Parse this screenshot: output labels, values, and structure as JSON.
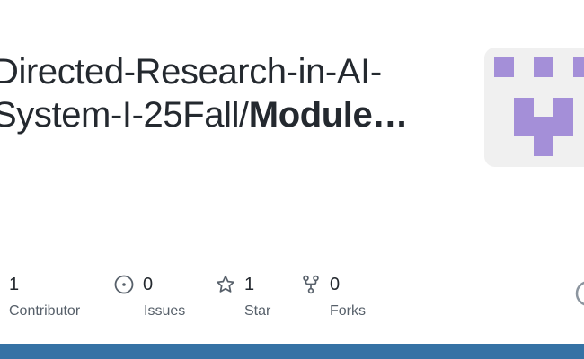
{
  "repo": {
    "title_line1": "Directed-Research-in-AI-",
    "title_line2_prefix": "System-I-25Fall/",
    "title_line2_bold": "Module…"
  },
  "stats": {
    "contributors": {
      "count": "1",
      "label": "Contributor",
      "icon": "people-icon"
    },
    "issues": {
      "count": "0",
      "label": "Issues",
      "icon": "issue-opened-icon"
    },
    "stars": {
      "count": "1",
      "label": "Star",
      "icon": "star-icon"
    },
    "forks": {
      "count": "0",
      "label": "Forks",
      "icon": "repo-forked-icon"
    }
  },
  "colors": {
    "avatar_bg": "#f0f0f0",
    "avatar_identicon": "#a48fd8",
    "language_bar": "#3572a5",
    "text_primary": "#24292f",
    "text_muted": "#57606a"
  }
}
